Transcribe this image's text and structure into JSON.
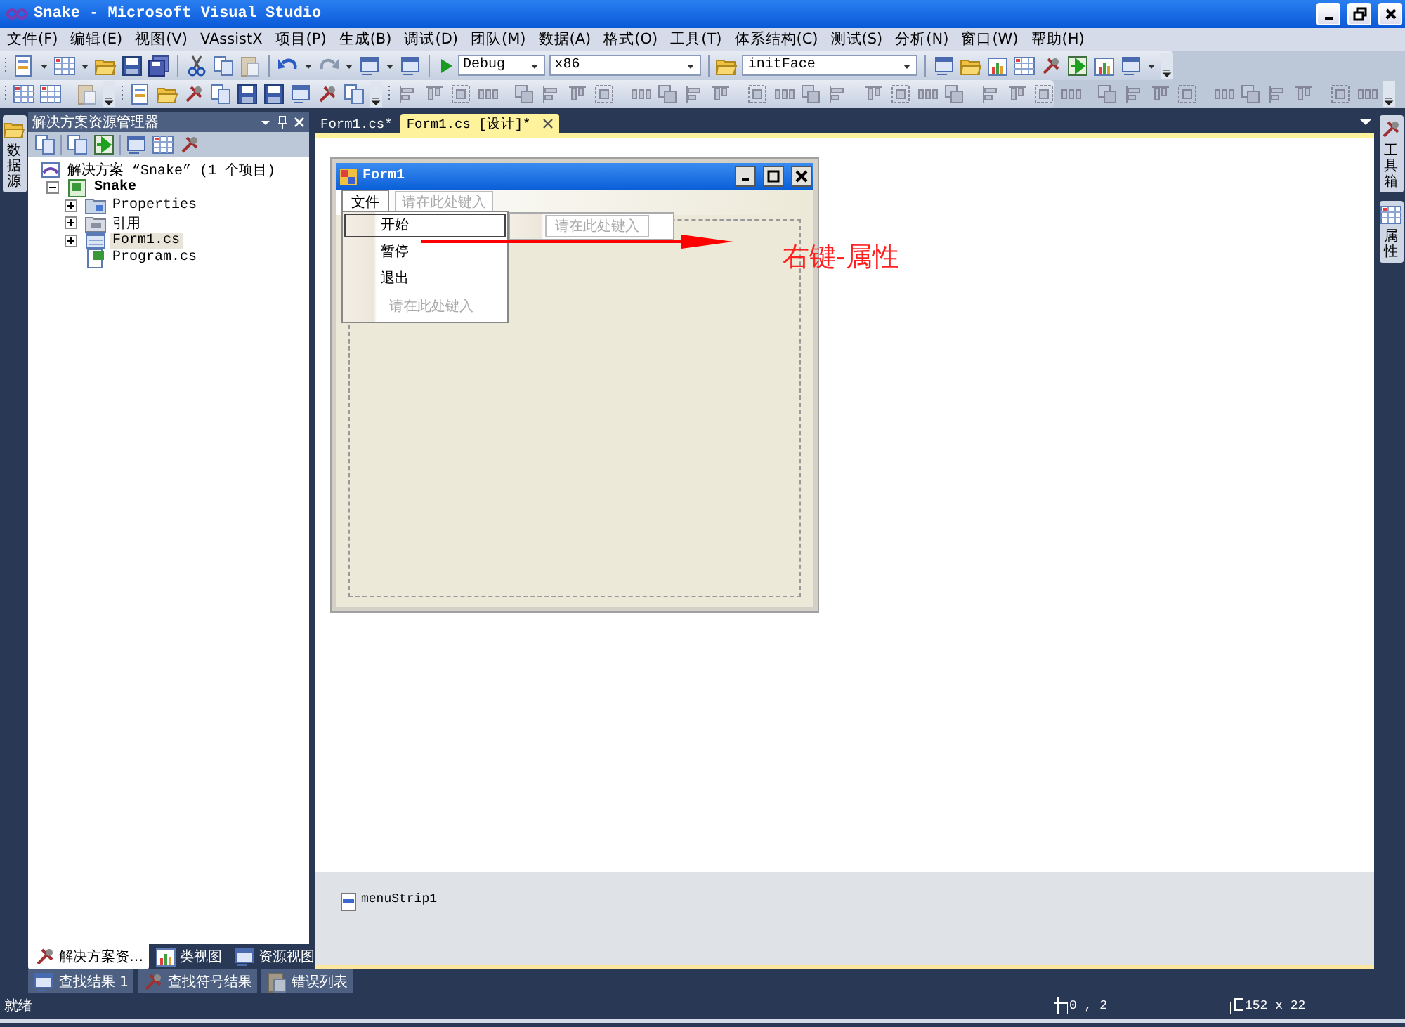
{
  "window": {
    "title": "Snake - Microsoft Visual Studio"
  },
  "menu": [
    "文件(F)",
    "编辑(E)",
    "视图(V)",
    "VAssistX",
    "项目(P)",
    "生成(B)",
    "调试(D)",
    "团队(M)",
    "数据(A)",
    "格式(O)",
    "工具(T)",
    "体系结构(C)",
    "测试(S)",
    "分析(N)",
    "窗口(W)",
    "帮助(H)"
  ],
  "toolbar": {
    "configuration": "Debug",
    "platform": "x86",
    "find": "initFace"
  },
  "left_side_tabs": [
    "数据源"
  ],
  "solution_explorer": {
    "title": "解决方案资源管理器",
    "tree": [
      {
        "label": "解决方案 “Snake” (1 个项目)",
        "kind": "solution",
        "selected": false,
        "children": [
          {
            "label": "Snake",
            "kind": "project",
            "expanded": true,
            "selected": false,
            "children": [
              {
                "label": "Properties",
                "kind": "properties",
                "expanded": false,
                "selected": false
              },
              {
                "label": "引用",
                "kind": "references",
                "expanded": false,
                "selected": false
              },
              {
                "label": "Form1.cs",
                "kind": "form",
                "expanded": false,
                "selected": true
              },
              {
                "label": "Program.cs",
                "kind": "code",
                "selected": false
              }
            ]
          }
        ]
      }
    ],
    "tabs": [
      {
        "label": "解决方案资…",
        "selected": true
      },
      {
        "label": "类视图",
        "selected": false
      },
      {
        "label": "资源视图",
        "selected": false
      }
    ]
  },
  "document_tabs": [
    {
      "label": "Form1.cs*",
      "selected": false
    },
    {
      "label": "Form1.cs [设计]*",
      "selected": true
    }
  ],
  "form": {
    "title": "Form1",
    "menu": [
      {
        "label": "文件",
        "kind": "item",
        "selected": true
      },
      {
        "label": "请在此处键入",
        "kind": "placeholder",
        "selected": false
      }
    ],
    "dropdown": [
      {
        "label": "开始",
        "kind": "item",
        "selected": true
      },
      {
        "label": "暂停",
        "kind": "item",
        "selected": false
      },
      {
        "label": "退出",
        "kind": "item",
        "selected": false
      },
      {
        "label": "请在此处键入",
        "kind": "placeholder",
        "selected": false
      }
    ],
    "submenu": [
      {
        "label": "请在此处键入",
        "kind": "placeholder"
      }
    ]
  },
  "annotation": "右键-属性",
  "component_tray": [
    "menuStrip1"
  ],
  "right_side_tabs": [
    "工具箱",
    "属性"
  ],
  "bottom_tabs": [
    "查找结果 1",
    "查找符号结果",
    "错误列表"
  ],
  "status_bar": {
    "text": "就绪",
    "position": "0 , 2",
    "size": "152 x 22"
  }
}
